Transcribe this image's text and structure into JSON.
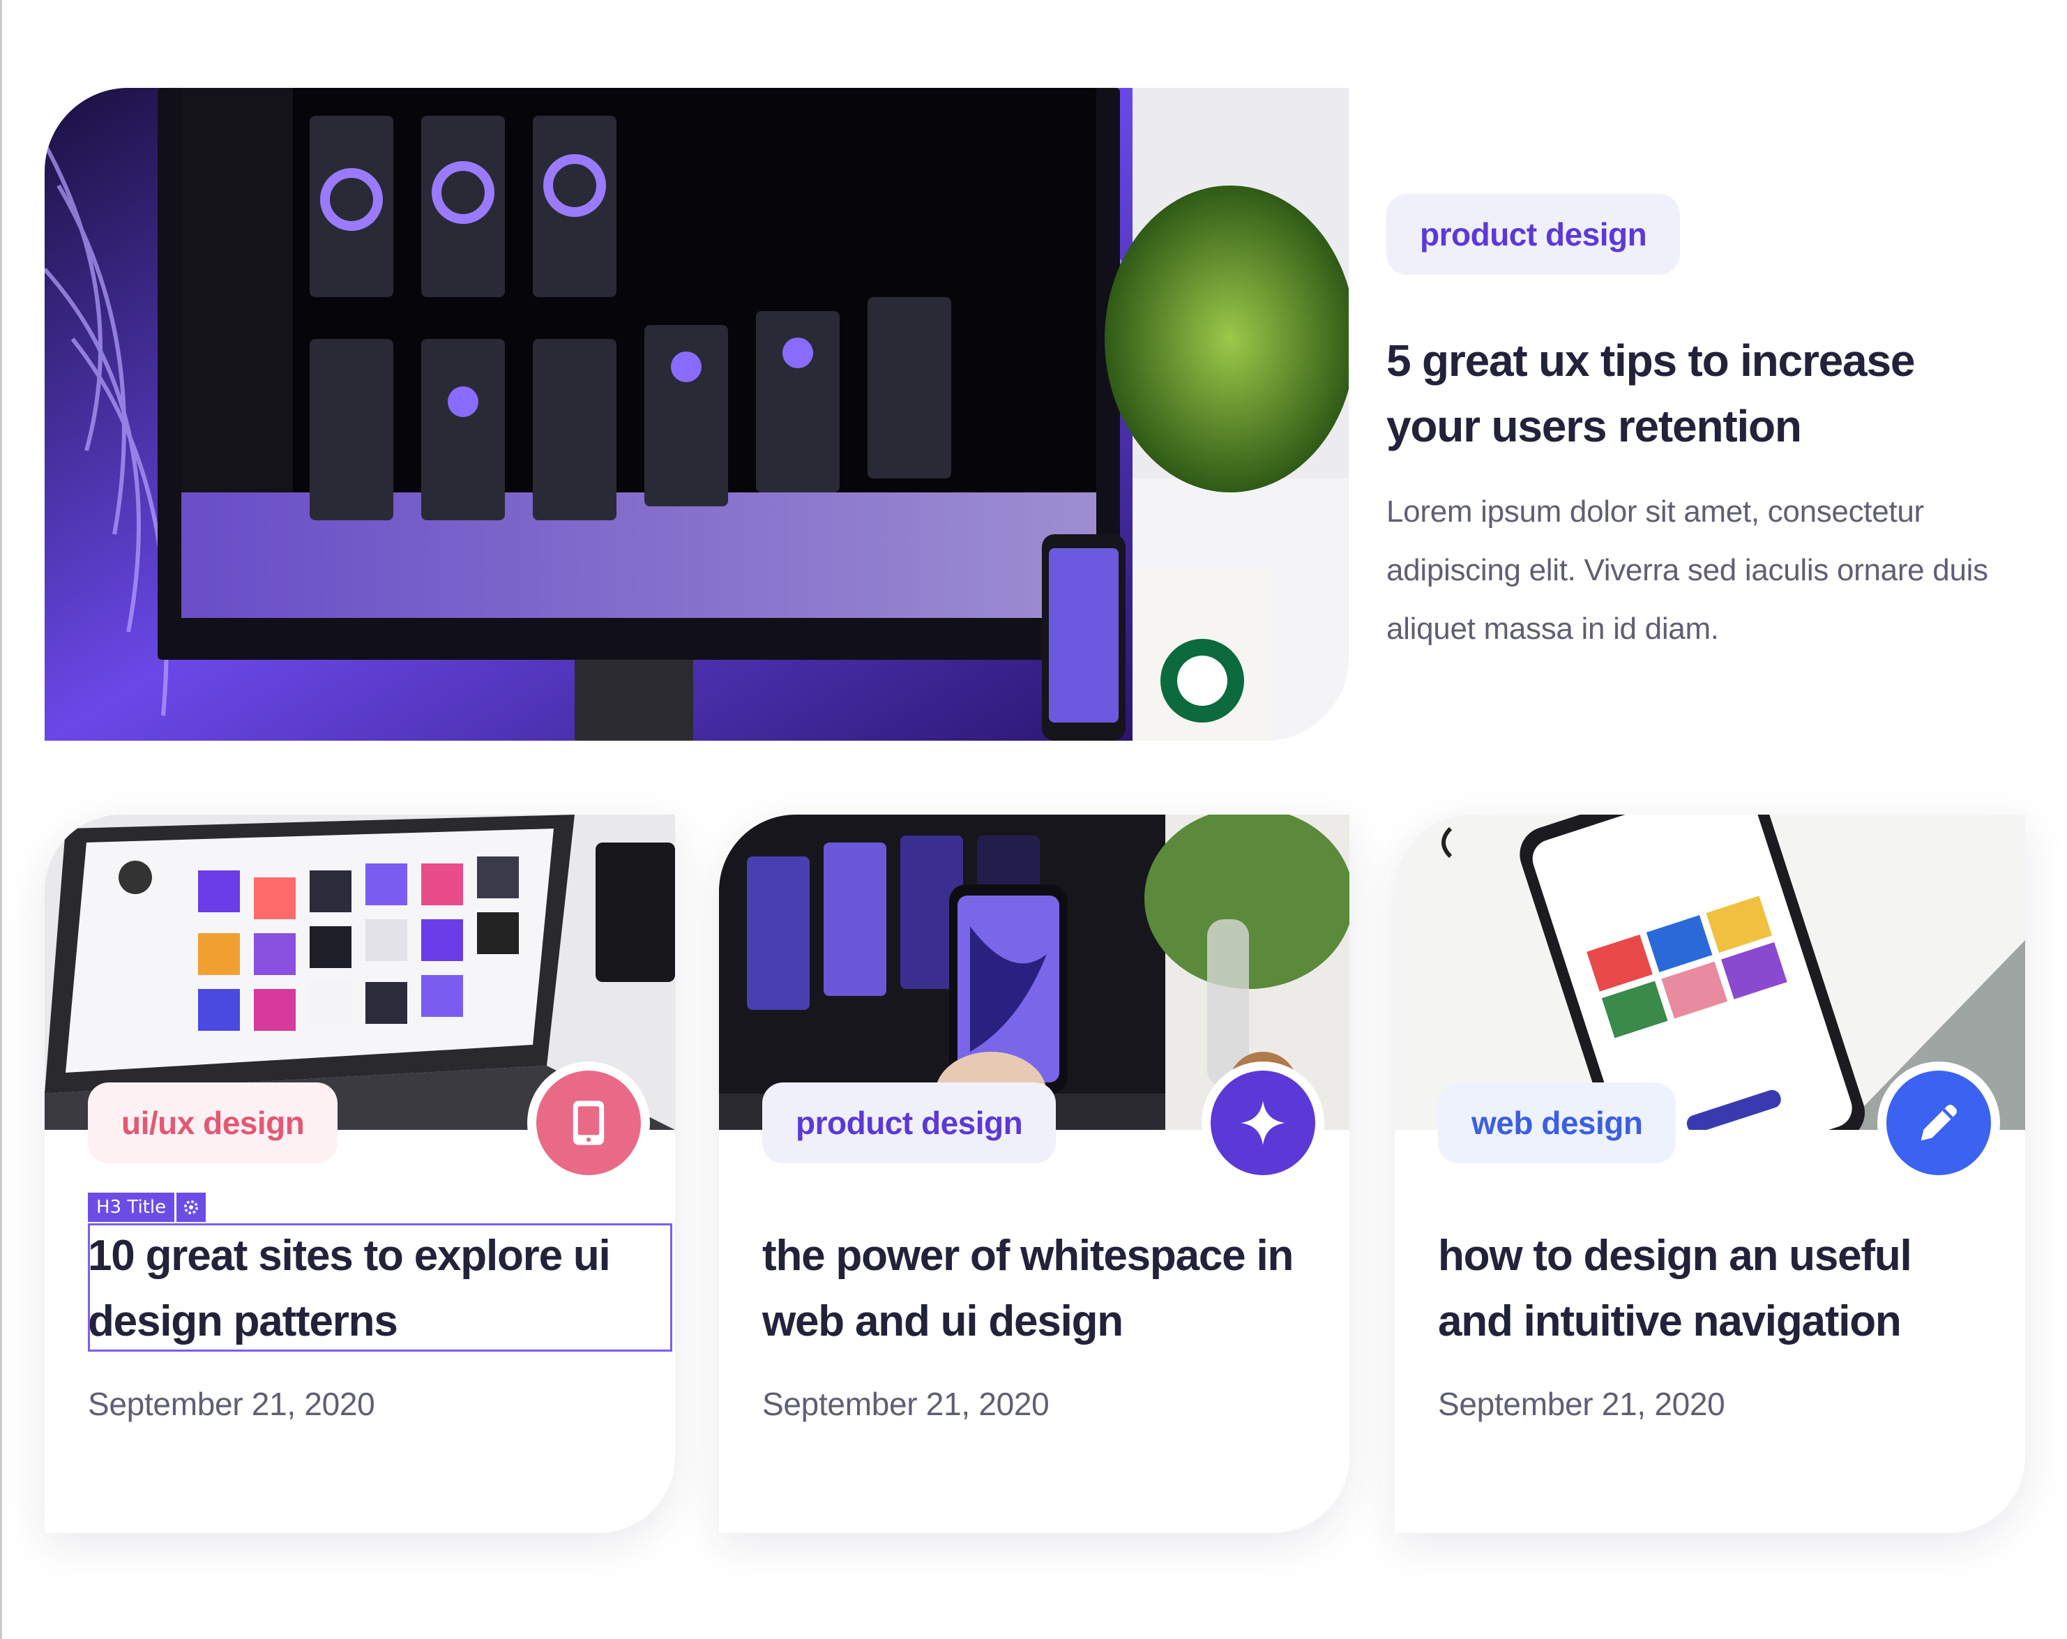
{
  "featured": {
    "tag": "product design",
    "title": "5 great ux tips to increase your users retention",
    "excerpt": "Lorem ipsum dolor sit amet, consectetur adipiscing elit. Viverra sed iaculis ornare duis aliquet massa in id diam."
  },
  "cards": [
    {
      "tag": "ui/ux design",
      "icon": "tablet-icon",
      "accent": "#e86a86",
      "title": "10 great sites to explore ui design patterns",
      "date": "September 21, 2020"
    },
    {
      "tag": "product design",
      "icon": "sparkle-icon",
      "accent": "#5b39d6",
      "title": "the power of whitespace in web and ui design",
      "date": "September 21, 2020"
    },
    {
      "tag": "web design",
      "icon": "pencil-icon",
      "accent": "#3b62f0",
      "title": "how to design an useful and intuitive navigation",
      "date": "September 21, 2020"
    }
  ],
  "editor": {
    "tag_label": "H3 Title"
  }
}
